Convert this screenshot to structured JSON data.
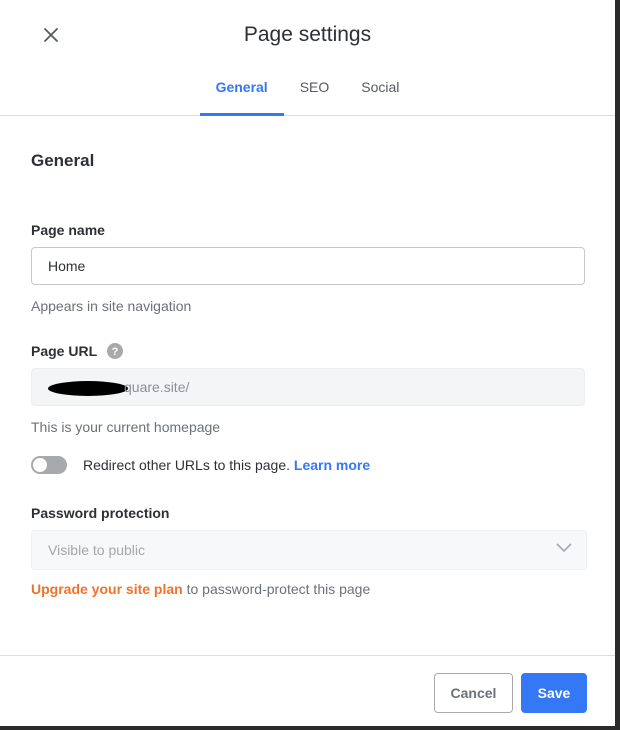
{
  "header": {
    "title": "Page settings",
    "close_icon": "close-icon"
  },
  "tabs": [
    {
      "label": "General",
      "active": true
    },
    {
      "label": "SEO"
    },
    {
      "label": "Social"
    }
  ],
  "general": {
    "section_title": "General",
    "page_name": {
      "label": "Page name",
      "value": "Home",
      "help": "Appears in site navigation"
    },
    "page_url": {
      "label": "Page URL",
      "value_visible": "quare.site/",
      "help": "This is your current homepage"
    },
    "redirect": {
      "enabled": false,
      "text": "Redirect other URLs to this page.",
      "link": "Learn more"
    },
    "password": {
      "label": "Password protection",
      "selected": "Visible to public",
      "upgrade_link": "Upgrade your site plan",
      "upgrade_text": " to password-protect this page"
    }
  },
  "footer": {
    "cancel": "Cancel",
    "save": "Save"
  },
  "colors": {
    "accent": "#3478f6",
    "upgrade": "#f0732a",
    "text": "#2d3035",
    "muted": "#6c7078"
  }
}
